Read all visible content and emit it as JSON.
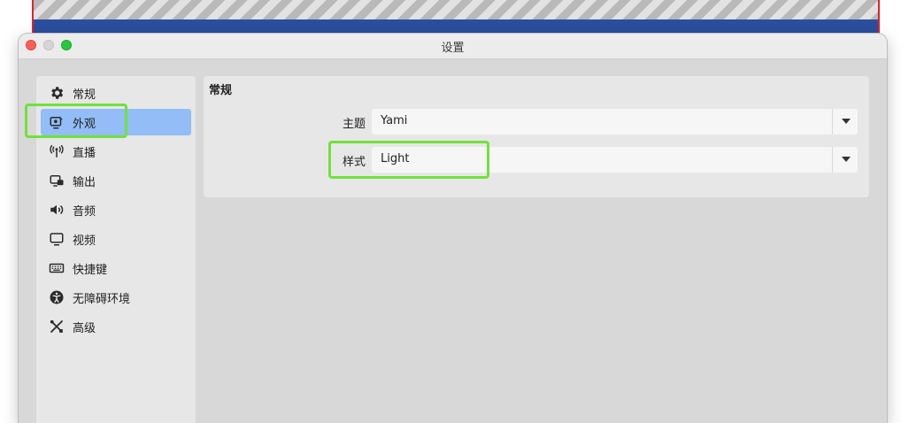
{
  "window": {
    "title": "设置"
  },
  "sidebar": {
    "items": [
      {
        "label": "常规",
        "icon": "gear-icon"
      },
      {
        "label": "外观",
        "icon": "appearance-icon",
        "selected": true
      },
      {
        "label": "直播",
        "icon": "broadcast-antenna-icon"
      },
      {
        "label": "输出",
        "icon": "output-icon"
      },
      {
        "label": "音频",
        "icon": "speaker-icon"
      },
      {
        "label": "视频",
        "icon": "monitor-icon"
      },
      {
        "label": "快捷键",
        "icon": "keyboard-icon"
      },
      {
        "label": "无障碍环境",
        "icon": "accessibility-icon"
      },
      {
        "label": "高级",
        "icon": "tools-icon"
      }
    ]
  },
  "panel": {
    "section_title": "常规",
    "fields": [
      {
        "label": "主题",
        "value": "Yami"
      },
      {
        "label": "样式",
        "value": "Light"
      }
    ]
  },
  "colors": {
    "selection": "#92bdf6",
    "highlight": "#6fe23a",
    "background_band": "#2b4f9e",
    "preview_border": "#e0242b"
  }
}
